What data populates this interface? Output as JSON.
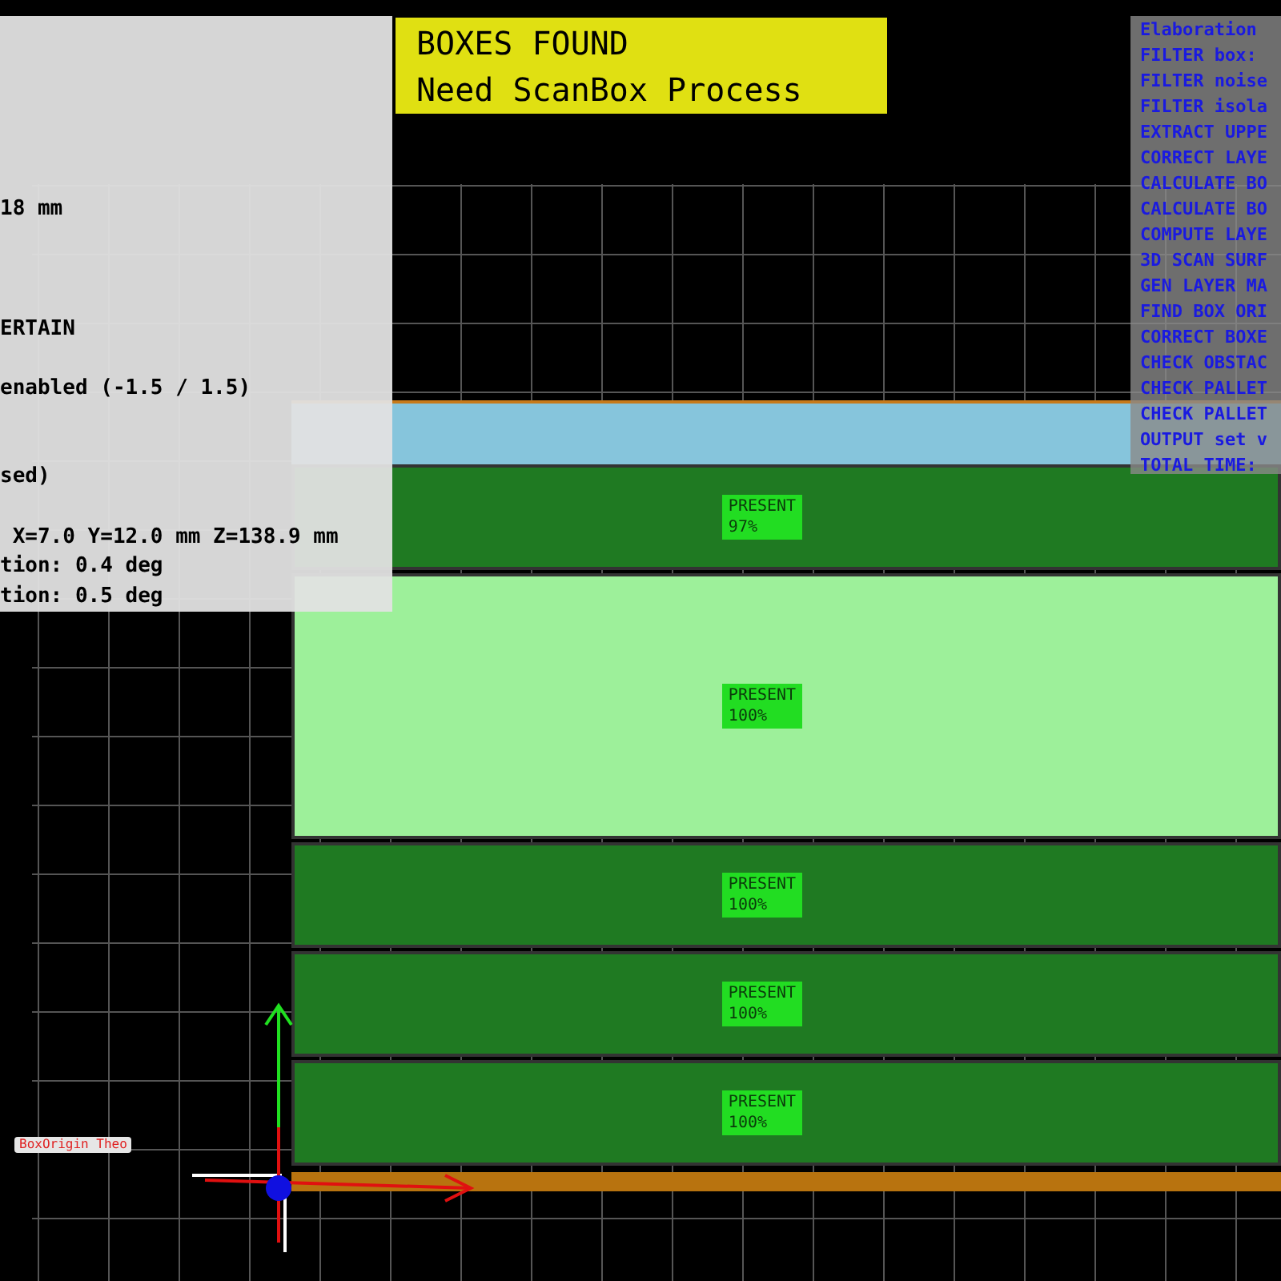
{
  "status_banner": {
    "lines": [
      "BOXES FOUND",
      "Need ScanBox Process"
    ]
  },
  "info_panel": {
    "lines": [
      {
        "text": "18 mm"
      },
      {
        "text": "ERTAIN"
      },
      {
        "text": "enabled (-1.5 / 1.5)"
      },
      {
        "text": "sed)"
      },
      {
        "text": "X=7.0 Y=12.0 mm Z=138.9 mm"
      },
      {
        "text": "tion: 0.4 deg"
      },
      {
        "text": "tion: 0.5 deg"
      }
    ]
  },
  "timing_panel": {
    "lines": [
      "Elaboration",
      "FILTER box:",
      "FILTER noise",
      "FILTER isola",
      "EXTRACT UPPE",
      "CORRECT LAYE",
      "CALCULATE BO",
      "CALCULATE BO",
      "COMPUTE LAYE",
      "3D SCAN SURF",
      "GEN LAYER MA",
      "FIND BOX ORI",
      "CORRECT BOXE",
      "CHECK OBSTAC",
      "CHECK PALLET",
      "CHECK PALLET",
      "OUTPUT set v",
      "TOTAL TIME:"
    ]
  },
  "boxes": [
    {
      "status": "PRESENT",
      "confidence": "97%",
      "color": "#1f7a22",
      "kind": "thin"
    },
    {
      "status": "PRESENT",
      "confidence": "100%",
      "color": "#9df09a",
      "kind": "tall"
    },
    {
      "status": "PRESENT",
      "confidence": "100%",
      "color": "#1f7a22",
      "kind": "thin"
    },
    {
      "status": "PRESENT",
      "confidence": "100%",
      "color": "#1f7a22",
      "kind": "thin"
    },
    {
      "status": "PRESENT",
      "confidence": "100%",
      "color": "#1f7a22",
      "kind": "thin"
    }
  ],
  "origin_label": "BoxOrigin Theo"
}
